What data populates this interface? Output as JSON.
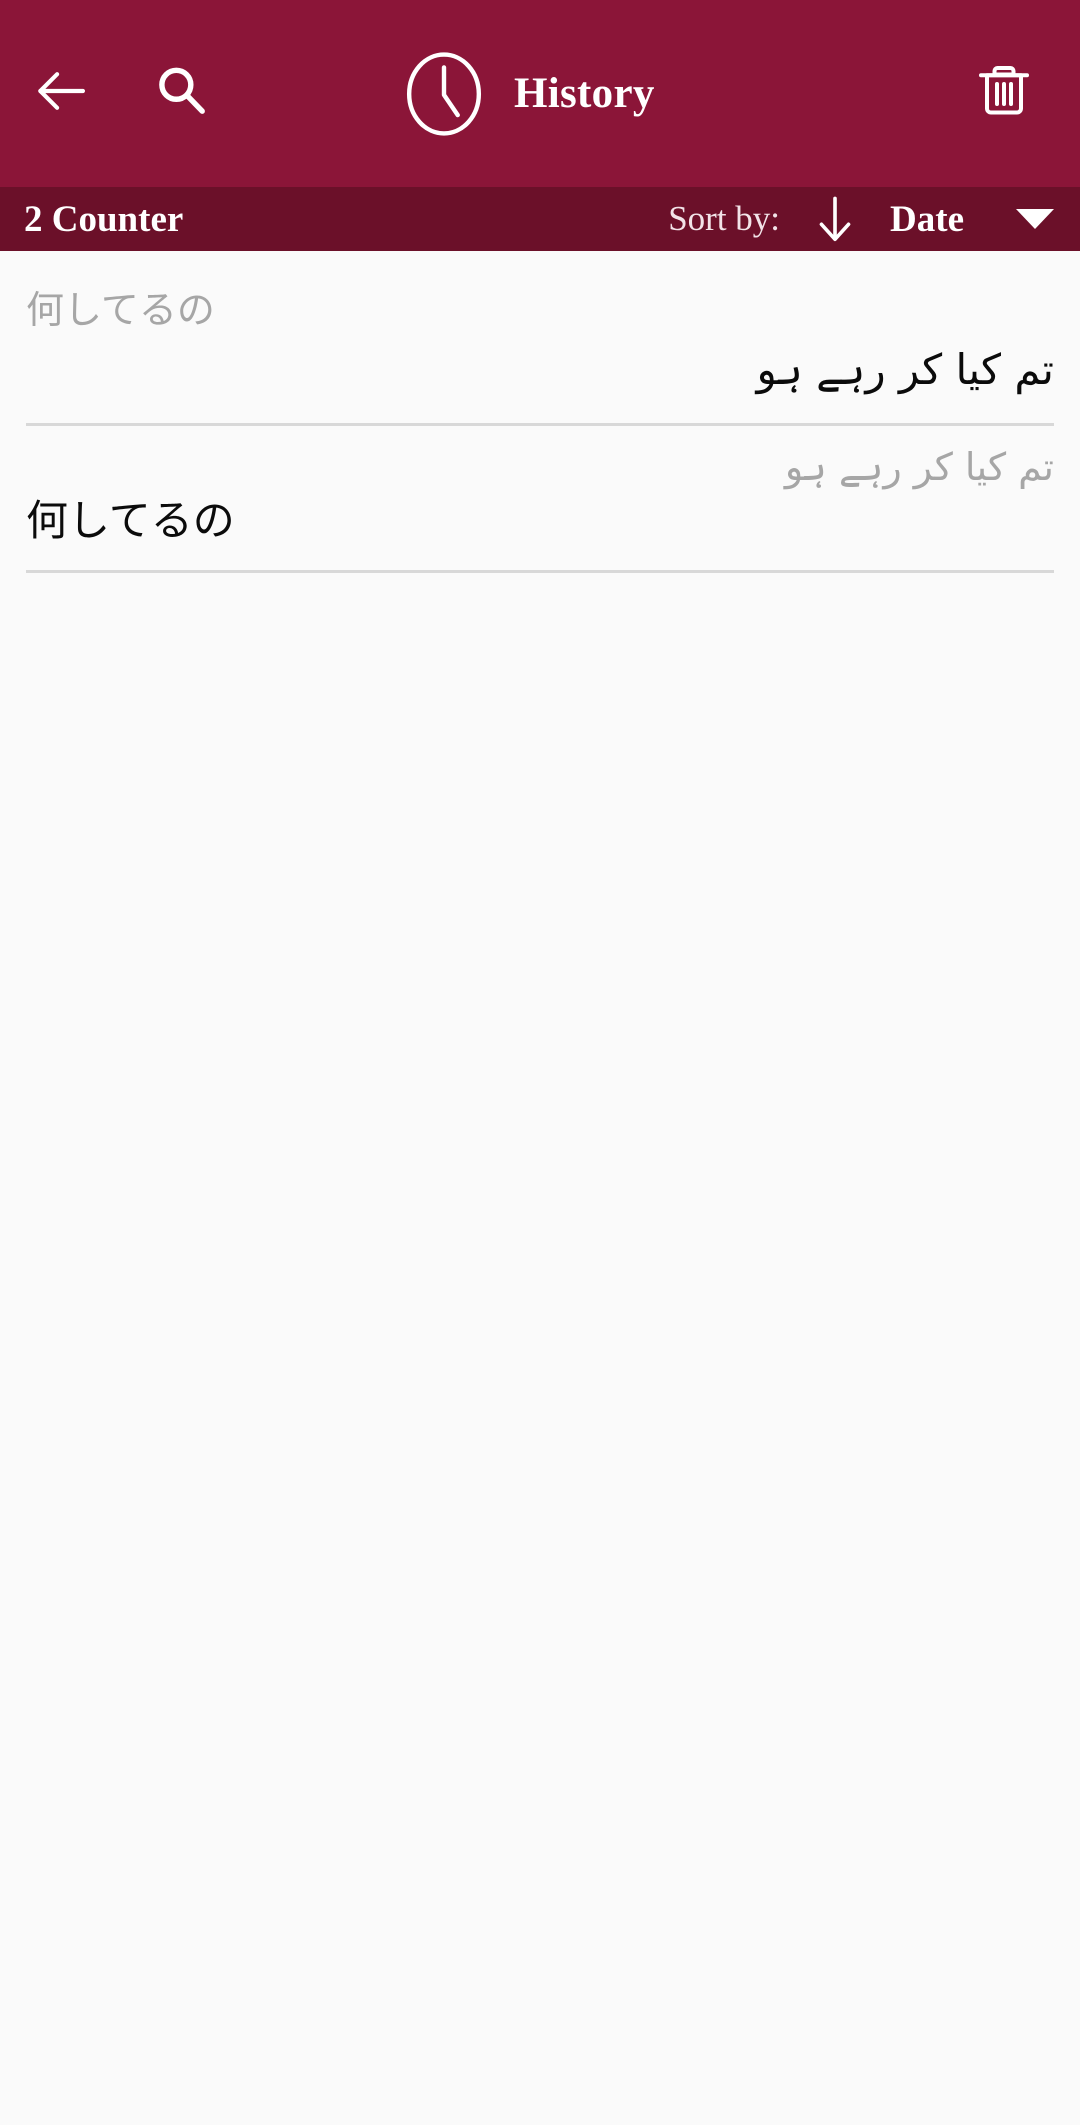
{
  "appbar": {
    "back_icon": "arrow-left-icon",
    "search_icon": "search-icon",
    "clock_icon": "clock-icon",
    "title": "History",
    "delete_icon": "trash-icon",
    "background_color": "#8B1538",
    "foreground_color": "#FFFFFF"
  },
  "subbar": {
    "counter_label": "2 Counter",
    "sort_by_label": "Sort by:",
    "sort_direction_icon": "arrow-down-icon",
    "sort_key_label": "Date",
    "dropdown_caret_icon": "caret-down-icon",
    "background_color": "#6B1029"
  },
  "history": {
    "items": [
      {
        "source_text": "何してるの",
        "source_dir": "ltr",
        "translated_text": "تم کیا کر رہے ہو",
        "translated_dir": "rtl"
      },
      {
        "source_text": "تم کیا کر رہے ہو",
        "source_dir": "rtl",
        "translated_text": "何してるの",
        "translated_dir": "ltr"
      }
    ]
  },
  "page": {
    "background_color": "#FAFAFA",
    "divider_color": "#D8D8D8",
    "source_text_color": "#A6A6A6",
    "translated_text_color": "#0B0B0B"
  }
}
